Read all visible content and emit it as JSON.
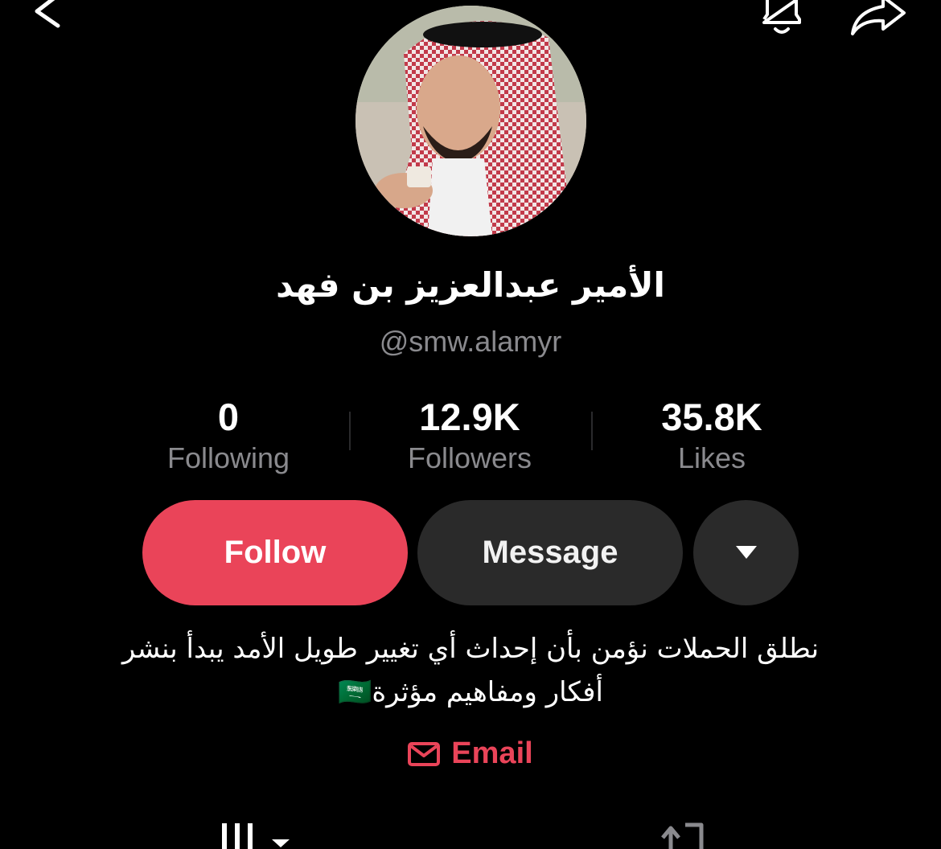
{
  "header": {
    "back_icon": "chevron-left-icon",
    "notify_icon": "bell-icon",
    "share_icon": "share-arrow-icon"
  },
  "profile": {
    "name": "الأمير عبدالعزيز بن فهد",
    "handle": "@smw.alamyr"
  },
  "stats": [
    {
      "value": "0",
      "label": "Following"
    },
    {
      "value": "12.9K",
      "label": "Followers"
    },
    {
      "value": "35.8K",
      "label": "Likes"
    }
  ],
  "actions": {
    "follow_label": "Follow",
    "message_label": "Message",
    "more_icon": "caret-down-icon"
  },
  "bio": {
    "line1": "نطلق الحملات نؤمن بأن إحداث أي تغيير طويل الأمد يبدأ بنشر",
    "line2": "أفكار ومفاهيم مؤثرة🇸🇦"
  },
  "email": {
    "label": "Email",
    "icon": "envelope-icon"
  },
  "colors": {
    "background": "#000000",
    "accent": "#ea4459",
    "muted_text": "#8a8a8e",
    "button_dark": "#2a2a2a"
  }
}
